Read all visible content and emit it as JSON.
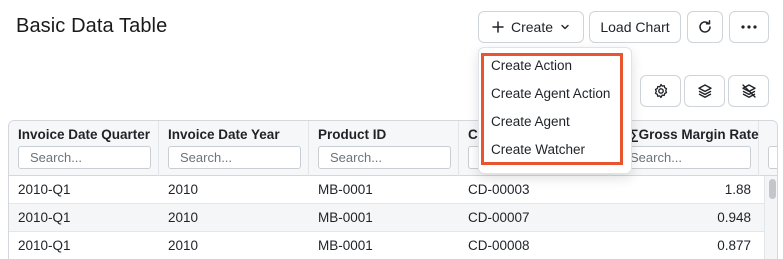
{
  "header": {
    "title": "Basic Data Table",
    "create_label": "Create",
    "load_chart_label": "Load Chart"
  },
  "icons": {
    "create": "plus-icon",
    "create_caret": "chevron-down-icon",
    "refresh": "refresh-icon",
    "more": "more-horizontal-icon",
    "settings": "gear-icon",
    "layers": "layers-icon",
    "layers_off": "layers-off-icon"
  },
  "create_menu": {
    "items": [
      {
        "label": "Create Action"
      },
      {
        "label": "Create Agent Action"
      },
      {
        "label": "Create Agent"
      },
      {
        "label": "Create Watcher"
      }
    ],
    "highlight_color": "#e8552e"
  },
  "table": {
    "columns": [
      {
        "label": "Invoice Date Quarter",
        "placeholder": "Search..."
      },
      {
        "label": "Invoice Date Year",
        "placeholder": "Search..."
      },
      {
        "label": "Product ID",
        "placeholder": "Search..."
      },
      {
        "label": "C",
        "placeholder": "Search..."
      },
      {
        "label": "∑Gross Margin Rate",
        "placeholder": "Search..."
      },
      {
        "label": "",
        "placeholder": ""
      }
    ],
    "rows": [
      [
        "2010-Q1",
        "2010",
        "MB-0001",
        "CD-00003",
        "1.88"
      ],
      [
        "2010-Q1",
        "2010",
        "MB-0001",
        "CD-00007",
        "0.948"
      ],
      [
        "2010-Q1",
        "2010",
        "MB-0001",
        "CD-00008",
        "0.877"
      ]
    ]
  }
}
